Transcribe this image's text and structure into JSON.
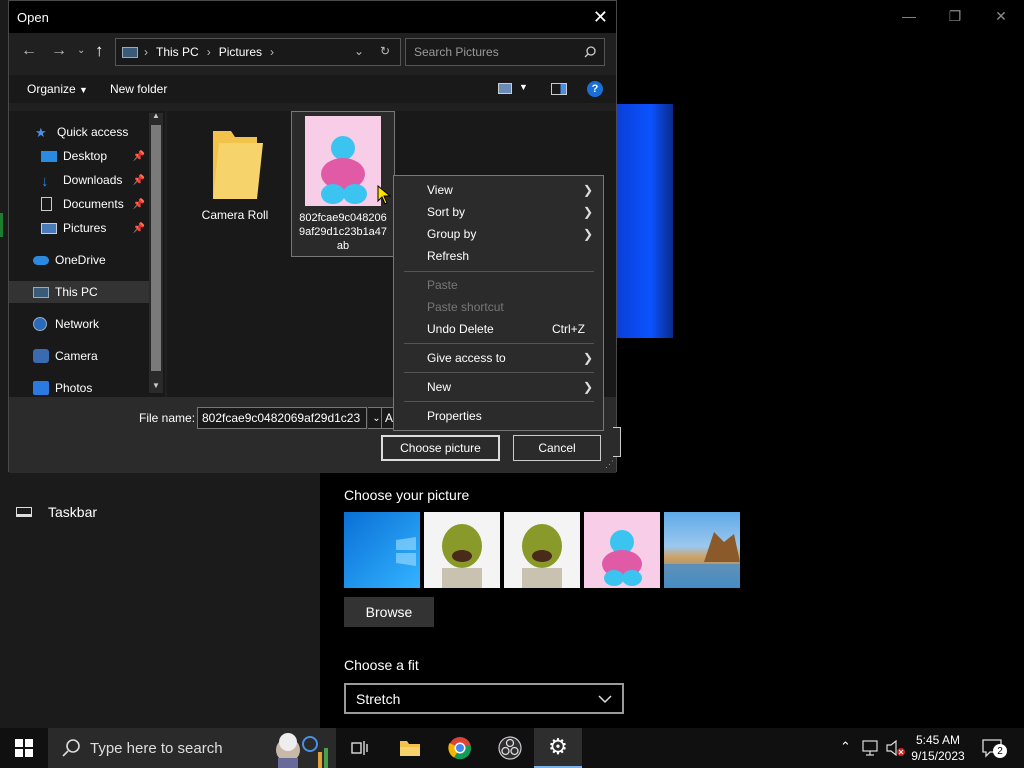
{
  "settings": {
    "sidebar_item_taskbar": "Taskbar",
    "choose_picture_label": "Choose your picture",
    "browse_label": "Browse",
    "choose_fit_label": "Choose a fit",
    "fit_value": "Stretch"
  },
  "dialog": {
    "title": "Open",
    "breadcrumb": [
      "This PC",
      "Pictures"
    ],
    "search_placeholder": "Search Pictures",
    "toolbar": {
      "organize": "Organize",
      "new_folder": "New folder"
    },
    "nav": [
      {
        "label": "Quick access",
        "icon": "star-icon"
      },
      {
        "label": "Desktop",
        "icon": "desktop-icon",
        "pinned": true
      },
      {
        "label": "Downloads",
        "icon": "download-icon",
        "pinned": true
      },
      {
        "label": "Documents",
        "icon": "document-icon",
        "pinned": true
      },
      {
        "label": "Pictures",
        "icon": "pictures-icon",
        "pinned": true
      },
      {
        "label": "OneDrive",
        "icon": "cloud-icon"
      },
      {
        "label": "This PC",
        "icon": "computer-icon",
        "selected": true
      },
      {
        "label": "Network",
        "icon": "network-icon"
      },
      {
        "label": "Camera",
        "icon": "camera-icon"
      },
      {
        "label": "Photos",
        "icon": "photos-icon"
      }
    ],
    "files": [
      {
        "name": "Camera Roll",
        "type": "folder"
      },
      {
        "name_lines": [
          "802fcae9c048206",
          "9af29d1c23b1a47",
          "ab"
        ],
        "type": "image"
      }
    ],
    "file_name_label": "File name:",
    "file_name_value": "802fcae9c0482069af29d1c23",
    "file_type_partial": "A",
    "choose_button": "Choose picture",
    "cancel_button": "Cancel"
  },
  "context_menu": {
    "items": [
      {
        "label": "View",
        "submenu": true
      },
      {
        "label": "Sort by",
        "submenu": true
      },
      {
        "label": "Group by",
        "submenu": true
      },
      {
        "label": "Refresh"
      },
      {
        "label": "Paste",
        "disabled": true
      },
      {
        "label": "Paste shortcut",
        "disabled": true
      },
      {
        "label": "Undo Delete",
        "shortcut": "Ctrl+Z"
      },
      {
        "label": "Give access to",
        "submenu": true
      },
      {
        "label": "New",
        "submenu": true
      },
      {
        "label": "Properties"
      }
    ]
  },
  "taskbar": {
    "search_placeholder": "Type here to search",
    "time": "5:45 AM",
    "date": "9/15/2023",
    "notification_count": "2"
  },
  "colors": {
    "accent_blue": "#0b53ff",
    "dialog_bg": "#202020",
    "taskbar_bg": "#101010"
  }
}
